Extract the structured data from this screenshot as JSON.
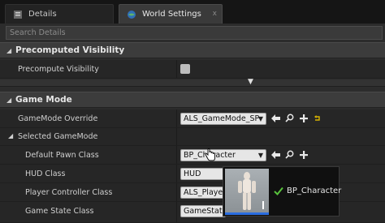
{
  "tabs": [
    {
      "label": "Details",
      "icon": "details-icon"
    },
    {
      "label": "World Settings",
      "icon": "globe-icon",
      "close": "x"
    }
  ],
  "search": {
    "placeholder": "Search Details"
  },
  "sections": {
    "precomputed": {
      "title": "Precomputed Visibility",
      "prop_label": "Precompute Visibility",
      "checked": false
    },
    "gamemode": {
      "title": "Game Mode",
      "override_label": "GameMode Override",
      "override_value": "ALS_GameMode_SP",
      "selected_label": "Selected GameMode",
      "pawn_label": "Default Pawn Class",
      "pawn_value": "BP_Character",
      "hud_label": "HUD Class",
      "hud_value": "HUD",
      "player_controller_label": "Player Controller Class",
      "player_controller_value": "ALS_Player",
      "game_state_label": "Game State Class",
      "game_state_value": "GameState"
    }
  },
  "tooltip": {
    "label": "BP_Character"
  },
  "colors": {
    "accent": "#2a6de0",
    "check": "#58c23c",
    "reset": "#d8b400"
  }
}
